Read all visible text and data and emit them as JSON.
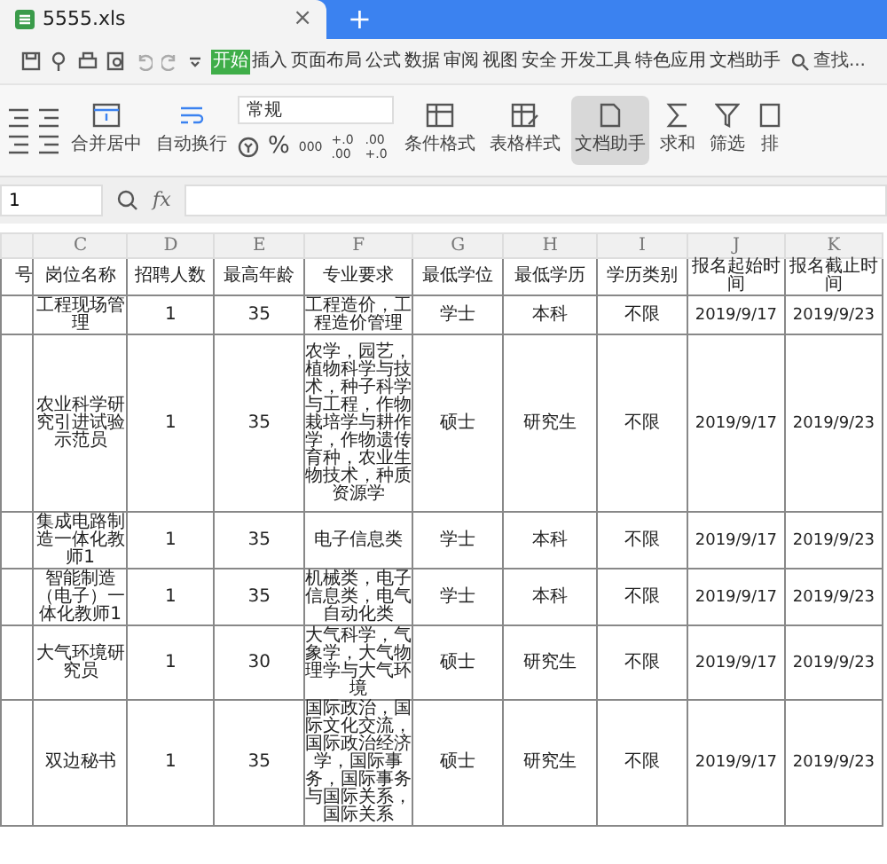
{
  "tabs": [
    {
      "label": "5555.xls",
      "selected": true,
      "close": "×"
    }
  ],
  "new_tab": "+",
  "menu": [
    {
      "label": "开始",
      "selected": true
    },
    {
      "label": "插入",
      "selected": false
    },
    {
      "label": "页面布局",
      "selected": false
    },
    {
      "label": "公式",
      "selected": false
    },
    {
      "label": "数据",
      "selected": false
    },
    {
      "label": "审阅",
      "selected": false
    },
    {
      "label": "视图",
      "selected": false
    },
    {
      "label": "安全",
      "selected": false
    },
    {
      "label": "开发工具",
      "selected": false
    },
    {
      "label": "特色应用",
      "selected": false
    },
    {
      "label": "文档助手",
      "selected": false
    }
  ],
  "search": "查找...",
  "ribbon": {
    "merge": "合并居中",
    "wrap": "自动换行",
    "format_value": "常规",
    "percent": "%",
    "thousands": "000",
    "dec_inc": "+.0 .00",
    "dec_dec": ".00 +.0",
    "conditional": "条件格式",
    "table_style": "表格样式",
    "assistant": {
      "label": "文档助手",
      "selected": true
    },
    "sum": "求和",
    "filter": "筛选",
    "sort": "排"
  },
  "formula_bar": {
    "cell_ref": "1",
    "fx": "fx"
  },
  "columns": [
    "C",
    "D",
    "E",
    "F",
    "G",
    "H",
    "I",
    "J",
    "K"
  ],
  "first_column_header": "号",
  "table": {
    "header": [
      "岗位名称",
      "招聘人数",
      "最高年龄",
      "专业要求",
      "最低学位",
      "最低学历",
      "学历类别",
      "报名起始时间",
      "报名截止时间"
    ],
    "rows": [
      [
        "工程现场管理",
        "1",
        "35",
        "工程造价，工程造价管理",
        "学士",
        "本科",
        "不限",
        "2019/9/17",
        "2019/9/23"
      ],
      [
        "农业科学研究引进试验示范员",
        "1",
        "35",
        "农学，园艺，植物科学与技术，种子科学与工程，作物栽培学与耕作学，作物遗传育种，农业生物技术，种质资源学",
        "硕士",
        "研究生",
        "不限",
        "2019/9/17",
        "2019/9/23"
      ],
      [
        "集成电路制造一体化教师1",
        "1",
        "35",
        "电子信息类",
        "学士",
        "本科",
        "不限",
        "2019/9/17",
        "2019/9/23"
      ],
      [
        "智能制造（电子）一体化教师1",
        "1",
        "35",
        "机械类，电子信息类，电气自动化类",
        "学士",
        "本科",
        "不限",
        "2019/9/17",
        "2019/9/23"
      ],
      [
        "大气环境研究员",
        "1",
        "30",
        "大气科学，气象学，大气物理学与大气环境",
        "硕士",
        "研究生",
        "不限",
        "2019/9/17",
        "2019/9/23"
      ],
      [
        "双边秘书",
        "1",
        "35",
        "国际政治，国际文化交流，国际政治经济学，国际事务，国际事务与国际关系，国际关系",
        "硕士",
        "研究生",
        "不限",
        "2019/9/17",
        "2019/9/23"
      ]
    ]
  }
}
